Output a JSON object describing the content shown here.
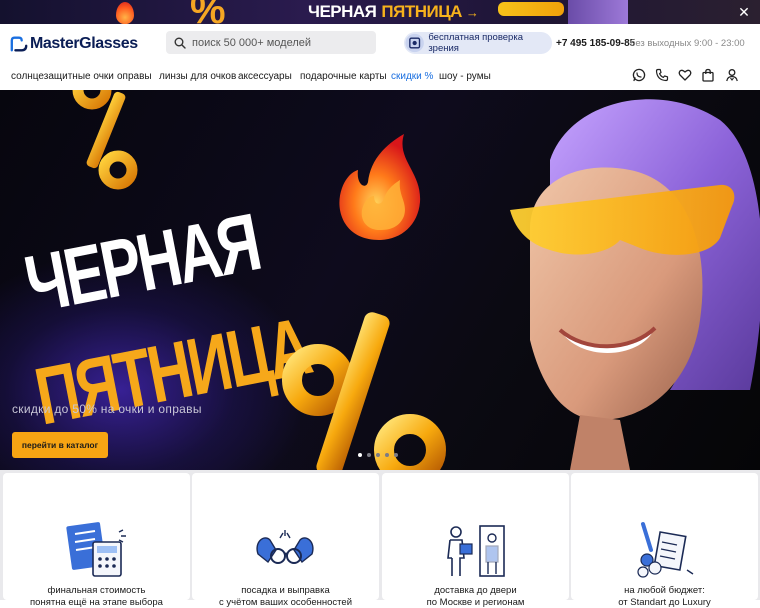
{
  "promo": {
    "text_white": "ЧЕРНАЯ",
    "text_yellow": "ПЯТНИЦА",
    "arrow": "→",
    "close": "✕"
  },
  "header": {
    "logo": "MasterGlasses",
    "search_placeholder": "поиск 50 000+ моделей",
    "eye_check": "бесплатная проверка зрения",
    "phone": "+7 495 185-09-85",
    "hours": "без выходных 9:00 - 23:00"
  },
  "nav": {
    "items": [
      {
        "label": "солнцезащитные очки"
      },
      {
        "label": "оправы"
      },
      {
        "label": "линзы для очков"
      },
      {
        "label": "аксессуары"
      },
      {
        "label": "подарочные карты"
      },
      {
        "label": "скидки %"
      },
      {
        "label": "шоу - румы"
      }
    ],
    "icons": [
      "whatsapp-icon",
      "phone-icon",
      "heart-icon",
      "bag-icon",
      "user-icon"
    ]
  },
  "hero": {
    "title_line1": "ЧЕРНАЯ",
    "title_line2": "ПЯТНИЦА",
    "subtitle": "скидки до 50% на очки и оправы",
    "cta": "перейти в каталог",
    "slides_count": 5,
    "active_slide": 0
  },
  "features": [
    {
      "title": "финальная стоимость",
      "subtitle": "понятна ещё на этапе выбора",
      "icon": "calculator-icon"
    },
    {
      "title": "посадка и выправка",
      "subtitle": "с учётом ваших особенностей",
      "icon": "glasses-fitting-icon"
    },
    {
      "title": "доставка до двери",
      "subtitle": "по Москве и регионам",
      "icon": "delivery-icon"
    },
    {
      "title": "на любой бюджет:",
      "subtitle": "от Standart до Luxury",
      "icon": "budget-icon"
    }
  ],
  "colors": {
    "accent_orange": "#f7a413",
    "brand_navy": "#0a1d55",
    "link_blue": "#1a6fe0",
    "hero_bg": "#0b0a12"
  }
}
